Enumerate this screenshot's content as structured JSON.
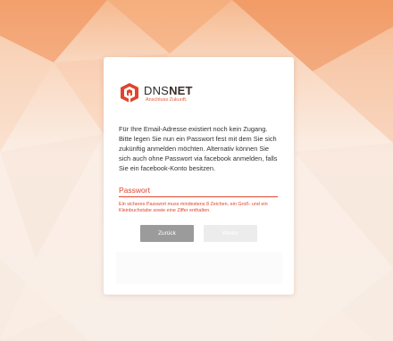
{
  "brand": {
    "name_light": "DNS",
    "name_bold": "NET",
    "tagline": "Anschluss Zukunft.",
    "logo_color": "#e0452c"
  },
  "message": "Für Ihre Email-Adresse existiert noch kein Zugang. Bitte legen Sie nun ein Passwort fest mit dem Sie sich zukünftig anmelden möchten. Alternativ können Sie sich auch ohne Passwort via facebook anmelden, falls Sie ein facebook-Konto besitzen.",
  "password_field": {
    "label": "Passwort",
    "value": "",
    "error": "Ein sicheres Passwort muss mindestens 8 Zeichen, ein Groß- und ein Kleinbuchstabe sowie eine Ziffer enthalten."
  },
  "buttons": {
    "back_label": "Zurück",
    "next_label": "Weiter"
  },
  "colors": {
    "accent": "#e0452c",
    "back_button": "#9b9b9b",
    "next_button_disabled": "#ececec"
  }
}
